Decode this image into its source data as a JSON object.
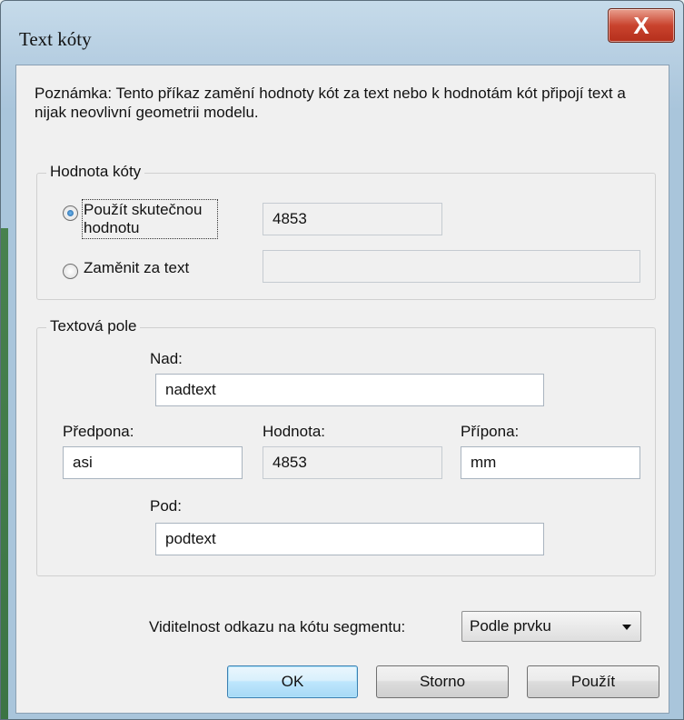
{
  "window": {
    "title": "Text kóty",
    "close_label": "X"
  },
  "note": "Poznámka: Tento příkaz zamění hodnoty kót za text nebo k hodnotám kót připojí text a nijak neovlivní geometrii modelu.",
  "hodnota_group": {
    "label": "Hodnota kóty",
    "radio_actual_label": "Použít skutečnou hodnotu",
    "radio_actual_checked": true,
    "radio_replace_label": "Zaměnit za text",
    "radio_replace_checked": false,
    "actual_value": "4853",
    "replace_value": ""
  },
  "text_group": {
    "label": "Textová pole",
    "above_label": "Nad:",
    "above_value": "nadtext",
    "prefix_label": "Předpona:",
    "prefix_value": "asi",
    "value_label": "Hodnota:",
    "value_value": "4853",
    "suffix_label": "Přípona:",
    "suffix_value": "mm",
    "below_label": "Pod:",
    "below_value": "podtext"
  },
  "visibility": {
    "label": "Viditelnost odkazu na kótu segmentu:",
    "selected": "Podle prvku"
  },
  "buttons": {
    "ok": "OK",
    "cancel": "Storno",
    "apply": "Použít"
  }
}
